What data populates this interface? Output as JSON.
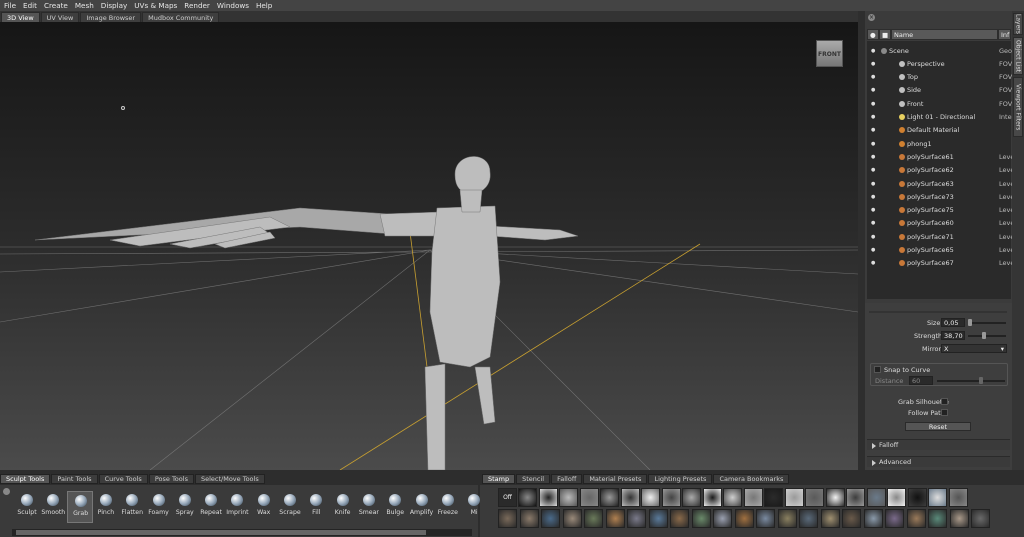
{
  "menubar": {
    "items": [
      "File",
      "Edit",
      "Create",
      "Mesh",
      "Display",
      "UVs & Maps",
      "Render",
      "Windows",
      "Help"
    ]
  },
  "view_tabs": [
    "3D View",
    "UV View",
    "Image Browser",
    "Mudbox Community"
  ],
  "viewport": {
    "cube_label": "FRONT"
  },
  "outliner": {
    "columns": [
      "Name",
      "Inf"
    ],
    "rows": [
      {
        "name": "Scene",
        "info": "Geo",
        "icon": "folder-icon"
      },
      {
        "name": "Perspective",
        "info": "FOV",
        "icon": "camera-icon"
      },
      {
        "name": "Top",
        "info": "FOV",
        "icon": "camera-icon"
      },
      {
        "name": "Side",
        "info": "FOV",
        "icon": "camera-icon"
      },
      {
        "name": "Front",
        "info": "FOV",
        "icon": "camera-icon"
      },
      {
        "name": "Light 01 - Directional",
        "info": "Inte",
        "icon": "light-icon"
      },
      {
        "name": "Default Material",
        "info": "",
        "icon": "material-icon"
      },
      {
        "name": "phong1",
        "info": "",
        "icon": "material-icon"
      },
      {
        "name": "polySurface61",
        "info": "Leve",
        "icon": "mesh-icon"
      },
      {
        "name": "polySurface62",
        "info": "Leve",
        "icon": "mesh-icon"
      },
      {
        "name": "polySurface63",
        "info": "Leve",
        "icon": "mesh-icon"
      },
      {
        "name": "polySurface73",
        "info": "Leve",
        "icon": "mesh-icon"
      },
      {
        "name": "polySurface75",
        "info": "Leve",
        "icon": "mesh-icon"
      },
      {
        "name": "polySurface60",
        "info": "Leve",
        "icon": "mesh-icon"
      },
      {
        "name": "polySurface71",
        "info": "Leve",
        "icon": "mesh-icon"
      },
      {
        "name": "polySurface65",
        "info": "Leve",
        "icon": "mesh-icon"
      },
      {
        "name": "polySurface67",
        "info": "Leve",
        "icon": "mesh-icon"
      }
    ]
  },
  "side_tabs": [
    "Layers",
    "Object List",
    "Viewport Filters"
  ],
  "properties": {
    "size_label": "Size",
    "size_value": "0,05",
    "strength_label": "Strength",
    "strength_value": "38,70",
    "mirror_label": "Mirror",
    "mirror_value": "X",
    "snap_label": "Snap to Curve",
    "distance_label": "Distance",
    "distance_value": "60",
    "grab_silhouette_label": "Grab Silhouette",
    "follow_path_label": "Follow Path",
    "reset_label": "Reset",
    "falloff_label": "Falloff",
    "advanced_label": "Advanced"
  },
  "tool_tabs": [
    "Sculpt Tools",
    "Paint Tools",
    "Curve Tools",
    "Pose Tools",
    "Select/Move Tools"
  ],
  "tools": [
    "Sculpt",
    "Smooth",
    "Grab",
    "Pinch",
    "Flatten",
    "Foamy",
    "Spray",
    "Repeat",
    "Imprint",
    "Wax",
    "Scrape",
    "Fill",
    "Knife",
    "Smear",
    "Bulge",
    "Amplify",
    "Freeze",
    "Mi"
  ],
  "selected_tool": "Grab",
  "tray_tabs": [
    "Stamp",
    "Stencil",
    "Falloff",
    "Material Presets",
    "Lighting Presets",
    "Camera Bookmarks"
  ],
  "stamps": {
    "off_label": "Off"
  }
}
